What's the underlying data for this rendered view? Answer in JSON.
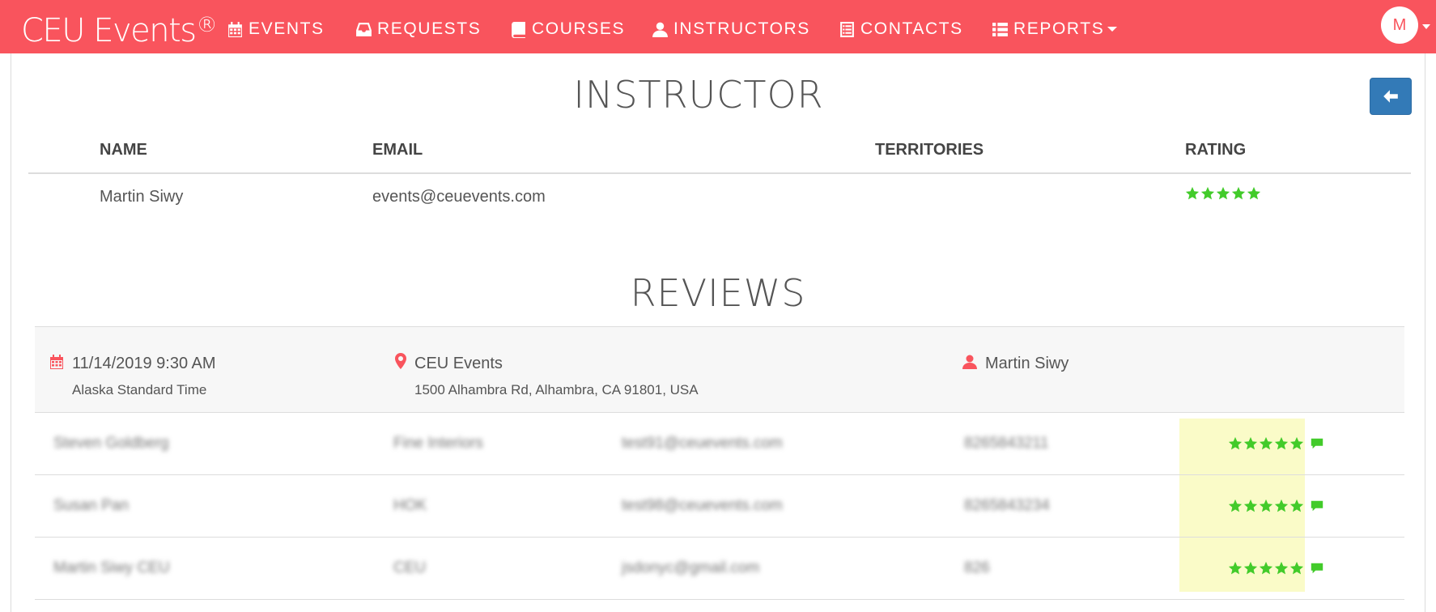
{
  "brand": {
    "name": "CEU Events",
    "mark": "®"
  },
  "nav": [
    {
      "label": "EVENTS",
      "icon": "calendar-icon"
    },
    {
      "label": "REQUESTS",
      "icon": "inbox-icon"
    },
    {
      "label": "COURSES",
      "icon": "book-icon"
    },
    {
      "label": "INSTRUCTORS",
      "icon": "user-icon"
    },
    {
      "label": "CONTACTS",
      "icon": "list-alt-icon"
    },
    {
      "label": "REPORTS",
      "icon": "list-icon"
    }
  ],
  "user": {
    "initial": "M"
  },
  "instructor": {
    "title": "INSTRUCTOR",
    "headers": {
      "name": "NAME",
      "email": "EMAIL",
      "territories": "TERRITORIES",
      "rating": "RATING"
    },
    "row": {
      "name": "Martin Siwy",
      "email": "events@ceuevents.com",
      "territories": "",
      "rating": 5
    }
  },
  "reviews": {
    "title": "REVIEWS",
    "event": {
      "datetime": "11/14/2019 9:30 AM",
      "timezone": "Alaska Standard Time",
      "venue": "CEU Events",
      "address": "1500 Alhambra Rd, Alhambra, CA 91801, USA",
      "instructor": "Martin Siwy"
    },
    "rows": [
      {
        "name": "Steven Goldberg",
        "company": "Fine Interiors",
        "email": "test91@ceuevents.com",
        "number": "8265843211",
        "rating": 5
      },
      {
        "name": "Susan Pan",
        "company": "HOK",
        "email": "test98@ceuevents.com",
        "number": "8265843234",
        "rating": 5
      },
      {
        "name": "Martin Siwy CEU",
        "company": "CEU",
        "email": "jsdonyc@gmail.com",
        "number": "826",
        "rating": 5
      }
    ]
  },
  "colors": {
    "brand": "#f9545d",
    "star": "#42cb2a",
    "rating_highlight": "#fafbc8",
    "back_button": "#337ab7"
  }
}
